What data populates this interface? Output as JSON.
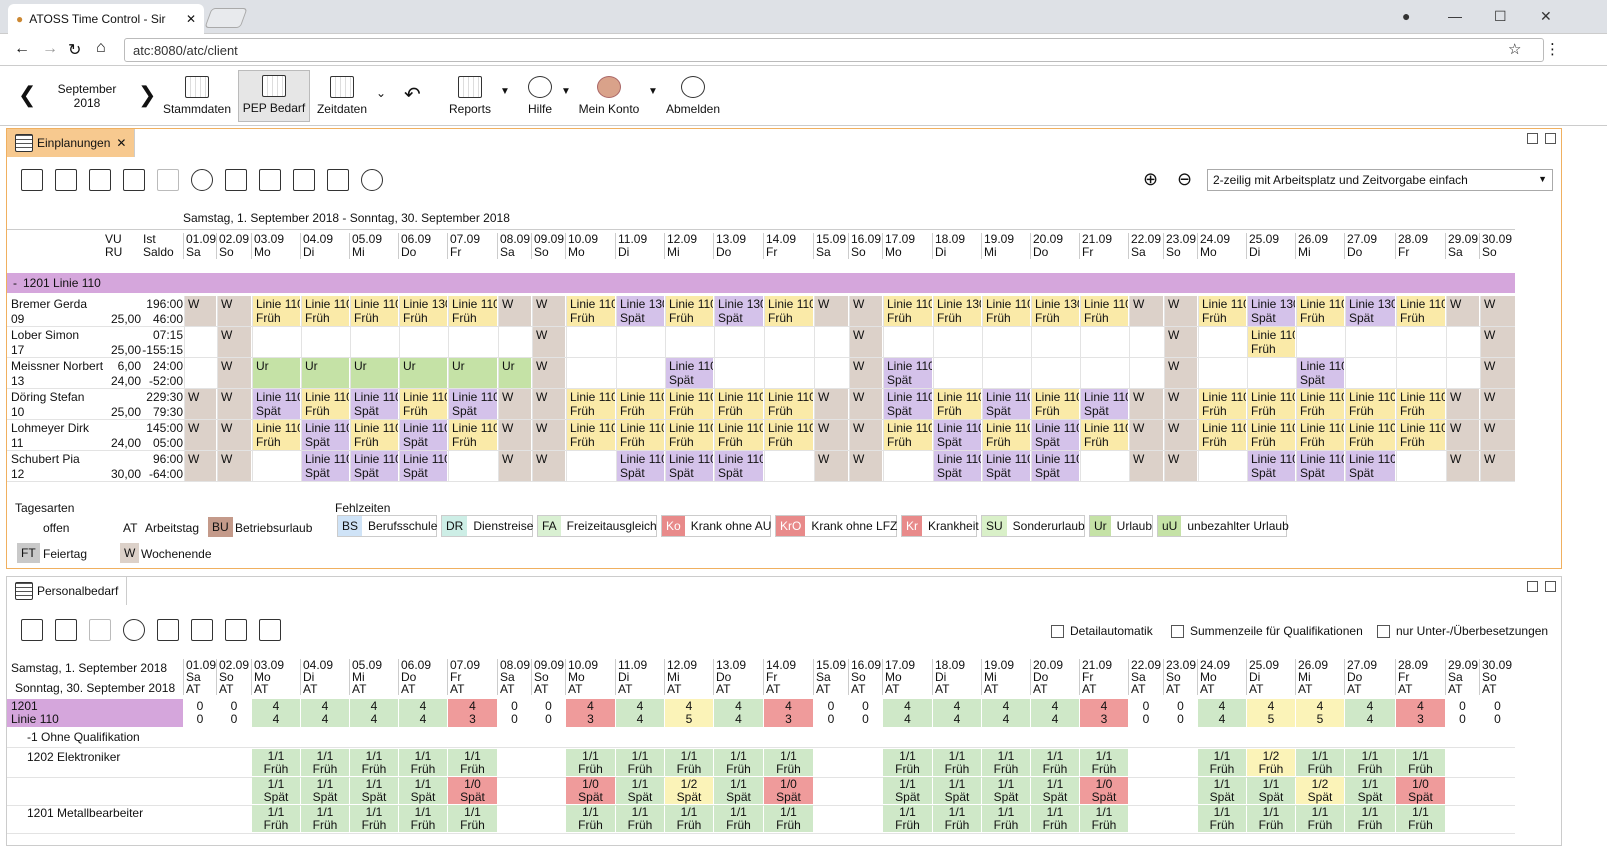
{
  "browser": {
    "tab_title": "ATOSS Time Control - Sir",
    "url": "atc:8080/atc/client"
  },
  "toolbar": {
    "month": "September",
    "year": "2018",
    "items": [
      "Stammdaten",
      "PEP Bedarf",
      "Zeitdaten",
      "Reports",
      "Hilfe",
      "Mein Konto",
      "Abmelden"
    ]
  },
  "einplanungen": {
    "tab": "Einplanungen",
    "view_select": "2-zeilig mit Arbeitsplatz und Zeitvorgabe einfach",
    "range": "Samstag, 1. September 2018 - Sonntag, 30. September 2018",
    "col_vu": "VU",
    "col_ru": "RU",
    "col_ist": "Ist",
    "col_saldo": "Saldo",
    "group": "1201 Linie 110",
    "group_toggle": "-",
    "dates": [
      "01.09",
      "02.09",
      "03.09",
      "04.09",
      "05.09",
      "06.09",
      "07.09",
      "08.09",
      "09.09",
      "10.09",
      "11.09",
      "12.09",
      "13.09",
      "14.09",
      "15.09",
      "16.09",
      "17.09",
      "18.09",
      "19.09",
      "20.09",
      "21.09",
      "22.09",
      "23.09",
      "24.09",
      "25.09",
      "26.09",
      "27.09",
      "28.09",
      "29.09",
      "30.09"
    ],
    "days": [
      "Sa",
      "So",
      "Mo",
      "Di",
      "Mi",
      "Do",
      "Fr",
      "Sa",
      "So",
      "Mo",
      "Di",
      "Mi",
      "Do",
      "Fr",
      "Sa",
      "So",
      "Mo",
      "Di",
      "Mi",
      "Do",
      "Fr",
      "Sa",
      "So",
      "Mo",
      "Di",
      "Mi",
      "Do",
      "Fr",
      "Sa",
      "So"
    ],
    "employees": [
      {
        "name": "Bremer Gerda",
        "id": "09",
        "vu": "",
        "ru": "25,00",
        "ist": "196:00",
        "saldo": "46:00",
        "cells": [
          "W",
          "W",
          "Linie 110|Früh",
          "Linie 110|Früh",
          "Linie 110|Früh",
          "Linie 130|Früh",
          "Linie 110|Früh",
          "W",
          "W",
          "Linie 110|Früh",
          "Linie 130|Spät",
          "Linie 110|Früh",
          "Linie 130|Spät",
          "Linie 110|Früh",
          "W",
          "W",
          "Linie 110|Früh",
          "Linie 130|Früh",
          "Linie 110|Früh",
          "Linie 130|Früh",
          "Linie 110|Früh",
          "W",
          "W",
          "Linie 110|Früh",
          "Linie 130|Spät",
          "Linie 110|Früh",
          "Linie 130|Spät",
          "Linie 110|Früh",
          "W",
          "W"
        ]
      },
      {
        "name": "Lober Simon",
        "id": "17",
        "vu": "",
        "ru": "25,00",
        "ist": "07:15",
        "saldo": "-155:15",
        "cells": [
          "",
          "W",
          "",
          "",
          "",
          "",
          "",
          "",
          "W",
          "",
          "",
          "",
          "",
          "",
          "",
          "W",
          "",
          "",
          "",
          "",
          "",
          "",
          "W",
          "",
          "Linie 110|Früh",
          "",
          "",
          "",
          "",
          "W"
        ]
      },
      {
        "name": "Meissner Norbert",
        "id": "13",
        "vu": "6,00",
        "ru": "24,00",
        "ist": "24:00",
        "saldo": "-52:00",
        "cells": [
          "",
          "W",
          "Ur",
          "Ur",
          "Ur",
          "Ur",
          "Ur",
          "Ur",
          "W",
          "",
          "",
          "Linie 110|Spät",
          "",
          "",
          "",
          "W",
          "Linie 110|Spät",
          "",
          "",
          "",
          "",
          "",
          "W",
          "",
          "",
          "Linie 110|Spät",
          "",
          "",
          "",
          "W"
        ]
      },
      {
        "name": "Döring Stefan",
        "id": "10",
        "vu": "",
        "ru": "25,00",
        "ist": "229:30",
        "saldo": "79:30",
        "cells": [
          "W",
          "W",
          "Linie 110|Spät",
          "Linie 110|Früh",
          "Linie 110|Spät",
          "Linie 110|Früh",
          "Linie 110|Spät",
          "W",
          "W",
          "Linie 110|Früh",
          "Linie 110|Früh",
          "Linie 110|Früh",
          "Linie 110|Früh",
          "Linie 110|Früh",
          "W",
          "W",
          "Linie 110|Spät",
          "Linie 110|Früh",
          "Linie 110|Spät",
          "Linie 110|Früh",
          "Linie 110|Spät",
          "W",
          "W",
          "Linie 110|Früh",
          "Linie 110|Früh",
          "Linie 110|Früh",
          "Linie 110|Früh",
          "Linie 110|Früh",
          "W",
          "W"
        ]
      },
      {
        "name": "Lohmeyer Dirk",
        "id": "11",
        "vu": "",
        "ru": "24,00",
        "ist": "145:00",
        "saldo": "05:00",
        "cells": [
          "W",
          "W",
          "Linie 110|Früh",
          "Linie 110|Spät",
          "Linie 110|Früh",
          "Linie 110|Spät",
          "Linie 110|Früh",
          "W",
          "W",
          "Linie 110|Früh",
          "Linie 110|Früh",
          "Linie 110|Früh",
          "Linie 110|Früh",
          "Linie 110|Früh",
          "W",
          "W",
          "Linie 110|Früh",
          "Linie 110|Spät",
          "Linie 110|Früh",
          "Linie 110|Spät",
          "Linie 110|Früh",
          "W",
          "W",
          "Linie 110|Früh",
          "Linie 110|Früh",
          "Linie 110|Früh",
          "Linie 110|Früh",
          "Linie 110|Früh",
          "W",
          "W"
        ]
      },
      {
        "name": "Schubert Pia",
        "id": "12",
        "vu": "",
        "ru": "30,00",
        "ist": "96:00",
        "saldo": "-64:00",
        "cells": [
          "W",
          "W",
          "",
          "Linie 110|Spät",
          "Linie 110|Spät",
          "Linie 110|Spät",
          "",
          "W",
          "W",
          "",
          "Linie 110|Spät",
          "Linie 110|Spät",
          "Linie 110|Spät",
          "",
          "W",
          "W",
          "",
          "Linie 110|Spät",
          "Linie 110|Spät",
          "Linie 110|Spät",
          "",
          "W",
          "W",
          "",
          "Linie 110|Spät",
          "Linie 110|Spät",
          "Linie 110|Spät",
          "",
          "W",
          "W"
        ]
      }
    ],
    "legend_tagesarten_title": "Tagesarten",
    "legend_tagesarten": [
      {
        "code": "",
        "label": "offen"
      },
      {
        "code": "AT",
        "label": "Arbeitstag"
      },
      {
        "code": "BU",
        "label": "Betriebsurlaub"
      },
      {
        "code": "FT",
        "label": "Feiertag"
      },
      {
        "code": "W",
        "label": "Wochenende"
      }
    ],
    "legend_fehlzeiten_title": "Fehlzeiten",
    "legend_fehlzeiten": [
      {
        "code": "BS",
        "label": "Berufsschule",
        "color": "#cfe3f7"
      },
      {
        "code": "DR",
        "label": "Dienstreise",
        "color": "#cdeee6"
      },
      {
        "code": "FA",
        "label": "Freizeitausgleich",
        "color": "#d9f0d2"
      },
      {
        "code": "Ko",
        "label": "Krank ohne AU",
        "color": "#e88a8a"
      },
      {
        "code": "KrO",
        "label": "Krank ohne LFZ",
        "color": "#e88a8a"
      },
      {
        "code": "Kr",
        "label": "Krankheit",
        "color": "#e88a8a"
      },
      {
        "code": "SU",
        "label": "Sonderurlaub",
        "color": "#d9f0c8"
      },
      {
        "code": "Ur",
        "label": "Urlaub",
        "color": "#c5e2a6"
      },
      {
        "code": "uU",
        "label": "unbezahlter Urlaub",
        "color": "#c5e2a6"
      }
    ]
  },
  "personalbedarf": {
    "tab": "Personalbedarf",
    "checkbox_detail": "Detailautomatik",
    "checkbox_summe": "Summenzeile für Qualifikationen",
    "checkbox_unter": "nur Unter-/Überbesetzungen",
    "range_line1": "Samstag, 1. September 2018",
    "range_line2": "Sonntag, 30. September 2018",
    "types": [
      "AT",
      "AT",
      "AT",
      "AT",
      "AT",
      "AT",
      "AT",
      "AT",
      "AT",
      "AT",
      "AT",
      "AT",
      "AT",
      "AT",
      "AT",
      "AT",
      "AT",
      "AT",
      "AT",
      "AT",
      "AT",
      "AT",
      "AT",
      "AT",
      "AT",
      "AT",
      "AT",
      "AT",
      "AT",
      "AT"
    ],
    "group_code": "1201",
    "group_name": "Linie 110",
    "group_cells": [
      "0|0",
      "0|0",
      "4|4",
      "4|4",
      "4|4",
      "4|4",
      "4|3",
      "0|0",
      "0|0",
      "4|3",
      "4|4",
      "4|5",
      "4|4",
      "4|3",
      "0|0",
      "0|0",
      "4|4",
      "4|4",
      "4|4",
      "4|4",
      "4|3",
      "0|0",
      "0|0",
      "4|4",
      "4|5",
      "4|5",
      "4|4",
      "4|3",
      "0|0",
      "0|0"
    ],
    "rows": [
      {
        "label": "-1 Ohne Qualifikation",
        "cells": []
      },
      {
        "label": "1202 Elektroniker",
        "cells": [
          "",
          "",
          "1/1|Früh",
          "1/1|Früh",
          "1/1|Früh",
          "1/1|Früh",
          "1/1|Früh",
          "",
          "",
          "1/1|Früh",
          "1/1|Früh",
          "1/1|Früh",
          "1/1|Früh",
          "1/1|Früh",
          "",
          "",
          "1/1|Früh",
          "1/1|Früh",
          "1/1|Früh",
          "1/1|Früh",
          "1/1|Früh",
          "",
          "",
          "1/1|Früh",
          "1/2|Früh",
          "1/1|Früh",
          "1/1|Früh",
          "1/1|Früh",
          "",
          ""
        ]
      },
      {
        "label": "",
        "cells": [
          "",
          "",
          "1/1|Spät",
          "1/1|Spät",
          "1/1|Spät",
          "1/1|Spät",
          "1/0|Spät",
          "",
          "",
          "1/0|Spät",
          "1/1|Spät",
          "1/2|Spät",
          "1/1|Spät",
          "1/0|Spät",
          "",
          "",
          "1/1|Spät",
          "1/1|Spät",
          "1/1|Spät",
          "1/1|Spät",
          "1/0|Spät",
          "",
          "",
          "1/1|Spät",
          "1/1|Spät",
          "1/2|Spät",
          "1/1|Spät",
          "1/0|Spät",
          "",
          ""
        ]
      },
      {
        "label": "1201 Metallbearbeiter",
        "cells": [
          "",
          "",
          "1/1|Früh",
          "1/1|Früh",
          "1/1|Früh",
          "1/1|Früh",
          "1/1|Früh",
          "",
          "",
          "1/1|Früh",
          "1/1|Früh",
          "1/1|Früh",
          "1/1|Früh",
          "1/1|Früh",
          "",
          "",
          "1/1|Früh",
          "1/1|Früh",
          "1/1|Früh",
          "1/1|Früh",
          "1/1|Früh",
          "",
          "",
          "1/1|Früh",
          "1/1|Früh",
          "1/1|Früh",
          "1/1|Früh",
          "1/1|Früh",
          "",
          ""
        ]
      }
    ]
  }
}
